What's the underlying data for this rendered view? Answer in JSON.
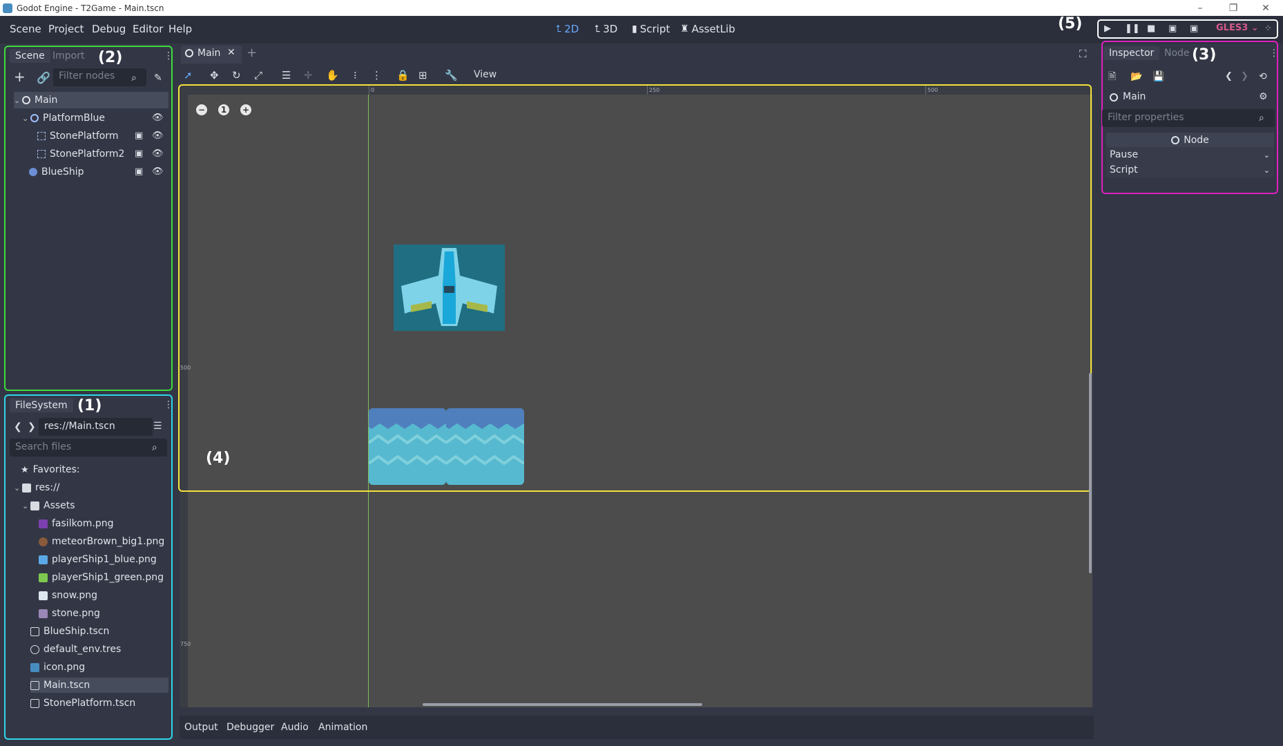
{
  "window": {
    "title": "Godot Engine - T2Game - Main.tscn",
    "min_glyph": "–",
    "max_glyph": "❐",
    "close_glyph": "✕"
  },
  "menu": {
    "items": [
      "Scene",
      "Project",
      "Debug",
      "Editor",
      "Help"
    ]
  },
  "workspaces": [
    {
      "label": "2D",
      "icon": "2d-icon",
      "glyph": "⮤",
      "active": true
    },
    {
      "label": "3D",
      "icon": "3d-icon",
      "glyph": "⮤",
      "active": false
    },
    {
      "label": "Script",
      "icon": "script-icon",
      "glyph": "▮",
      "active": false
    },
    {
      "label": "AssetLib",
      "icon": "assetlib-icon",
      "glyph": "♜",
      "active": false
    }
  ],
  "playbar": {
    "callout": "(5)",
    "renderer": "GLES3",
    "buttons": [
      "play-icon",
      "pause-icon",
      "stop-icon",
      "play-scene-icon",
      "play-custom-scene-icon"
    ]
  },
  "scene_dock": {
    "tabs": [
      "Scene",
      "Import"
    ],
    "callout": "(2)",
    "filter_placeholder": "Filter nodes",
    "tree": [
      {
        "label": "Main",
        "kind": "node",
        "depth": 0,
        "selected": true,
        "expanded": true
      },
      {
        "label": "PlatformBlue",
        "kind": "node",
        "depth": 1,
        "expanded": true,
        "visible_toggle": true
      },
      {
        "label": "StonePlatform",
        "kind": "sprite",
        "depth": 2,
        "scene_icon": true,
        "visible_toggle": true
      },
      {
        "label": "StonePlatform2",
        "kind": "sprite",
        "depth": 2,
        "scene_icon": true,
        "visible_toggle": true
      },
      {
        "label": "BlueShip",
        "kind": "globe",
        "depth": 1,
        "scene_icon": true,
        "visible_toggle": true
      }
    ]
  },
  "filesystem_dock": {
    "tab": "FileSystem",
    "callout": "(1)",
    "path": "res://Main.tscn",
    "search_placeholder": "Search files",
    "items": [
      {
        "label": "Favorites:",
        "icon": "star-icon",
        "depth": 0
      },
      {
        "label": "res://",
        "icon": "folder-icon",
        "depth": 0,
        "expanded": true
      },
      {
        "label": "Assets",
        "icon": "folder-icon",
        "depth": 1,
        "expanded": true
      },
      {
        "label": "fasilkom.png",
        "icon": "image-icon",
        "depth": 2,
        "color": "#7b3fb0"
      },
      {
        "label": "meteorBrown_big1.png",
        "icon": "image-icon",
        "depth": 2,
        "color": "#8a5a3c"
      },
      {
        "label": "playerShip1_blue.png",
        "icon": "image-icon",
        "depth": 2,
        "color": "#5aa9e6"
      },
      {
        "label": "playerShip1_green.png",
        "icon": "image-icon",
        "depth": 2,
        "color": "#7ec850"
      },
      {
        "label": "snow.png",
        "icon": "image-icon",
        "depth": 2,
        "color": "#dde6ee"
      },
      {
        "label": "stone.png",
        "icon": "image-icon",
        "depth": 2,
        "color": "#9b87b8"
      },
      {
        "label": "BlueShip.tscn",
        "icon": "scene-icon",
        "depth": 1
      },
      {
        "label": "default_env.tres",
        "icon": "globe-icon",
        "depth": 1
      },
      {
        "label": "icon.png",
        "icon": "godot-icon",
        "depth": 1,
        "color": "#478cbf"
      },
      {
        "label": "Main.tscn",
        "icon": "scene-icon",
        "depth": 1,
        "selected": true
      },
      {
        "label": "StonePlatform.tscn",
        "icon": "scene-icon",
        "depth": 1
      }
    ]
  },
  "editor": {
    "scene_tab": "Main",
    "callout": "(4)",
    "view_menu": "View",
    "ruler_labels": [
      "0",
      "250",
      "500"
    ],
    "ruler_left_labels": [
      "500",
      "750"
    ],
    "zoom_reset": "1"
  },
  "inspector": {
    "tabs": [
      "Inspector",
      "Node"
    ],
    "callout": "(3)",
    "object_name": "Main",
    "filter_placeholder": "Filter properties",
    "section": "Node",
    "properties": [
      "Pause",
      "Script"
    ]
  },
  "bottom_panel": {
    "tabs": [
      "Output",
      "Debugger",
      "Audio",
      "Animation"
    ]
  },
  "colors": {
    "scene_dock_outline": "#3ddc3d",
    "filesystem_outline": "#2ed6e8",
    "inspector_outline": "#e020c0",
    "viewport_outline": "#f2e33a",
    "playbar_outline": "#ffffff"
  }
}
